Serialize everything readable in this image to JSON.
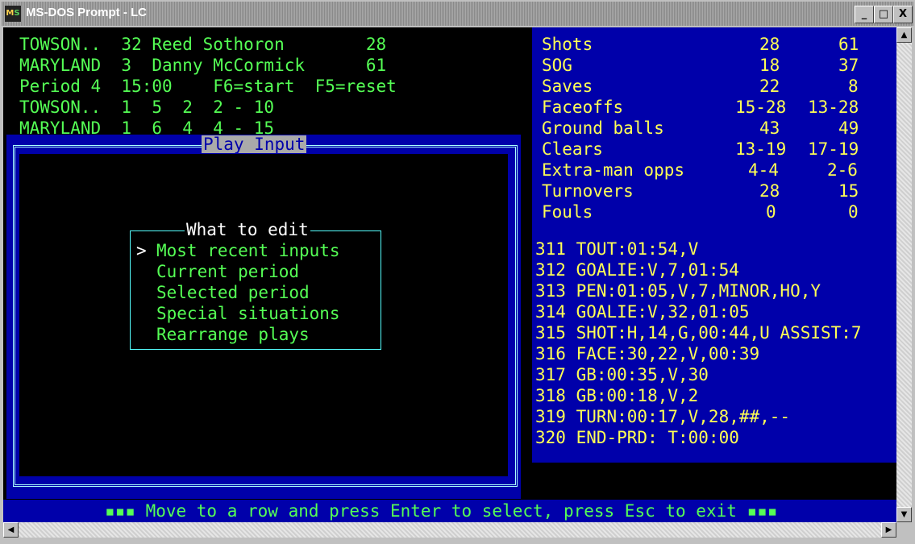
{
  "window": {
    "title": "MS-DOS Prompt - LC",
    "buttons": {
      "minimize": "_",
      "maximize": "□",
      "close": "X"
    }
  },
  "scoreboard": {
    "lines": [
      "TOWSON..  32 Reed Sothoron        28",
      "MARYLAND  3  Danny McCormick      61",
      "Period 4  15:00    F6=start  F5=reset",
      "TOWSON..  1  5  2  2 - 10",
      "MARYLAND  1  6  4  4 - 15"
    ]
  },
  "stats": {
    "rows": [
      {
        "label": "Shots",
        "away": "28",
        "home": "61"
      },
      {
        "label": "SOG",
        "away": "18",
        "home": "37"
      },
      {
        "label": "Saves",
        "away": "22",
        "home": "8"
      },
      {
        "label": "Faceoffs",
        "away": "15-28",
        "home": "13-28"
      },
      {
        "label": "Ground balls",
        "away": "43",
        "home": "49"
      },
      {
        "label": "Clears",
        "away": "13-19",
        "home": "17-19"
      },
      {
        "label": "Extra-man opps",
        "away": "4-4",
        "home": "2-6"
      },
      {
        "label": "Turnovers",
        "away": "28",
        "home": "15"
      },
      {
        "label": "Fouls",
        "away": "0",
        "home": "0"
      }
    ]
  },
  "play_log": [
    "311 TOUT:01:54,V",
    "312 GOALIE:V,7,01:54",
    "313 PEN:01:05,V,7,MINOR,HO,Y",
    "314 GOALIE:V,32,01:05",
    "315 SHOT:H,14,G,00:44,U ASSIST:7",
    "316 FACE:30,22,V,00:39",
    "317 GB:00:35,V,30",
    "318 GB:00:18,V,2",
    "319 TURN:00:17,V,28,##,--",
    "320 END-PRD: T:00:00"
  ],
  "play_input": {
    "title": "Play Input",
    "menu_title": "What to edit",
    "cursor": ">",
    "items": [
      "Most recent inputs",
      "Current period",
      "Selected period",
      "Special situations",
      "Rearrange plays"
    ]
  },
  "status_bar": {
    "text": "▪▪▪ Move to a row and press Enter to select, press Esc to exit ▪▪▪"
  },
  "colors": {
    "screen": "#000000",
    "panel": "#0000aa",
    "green": "#55ff55",
    "yellow": "#ffff55",
    "cyan": "#55ffff"
  }
}
